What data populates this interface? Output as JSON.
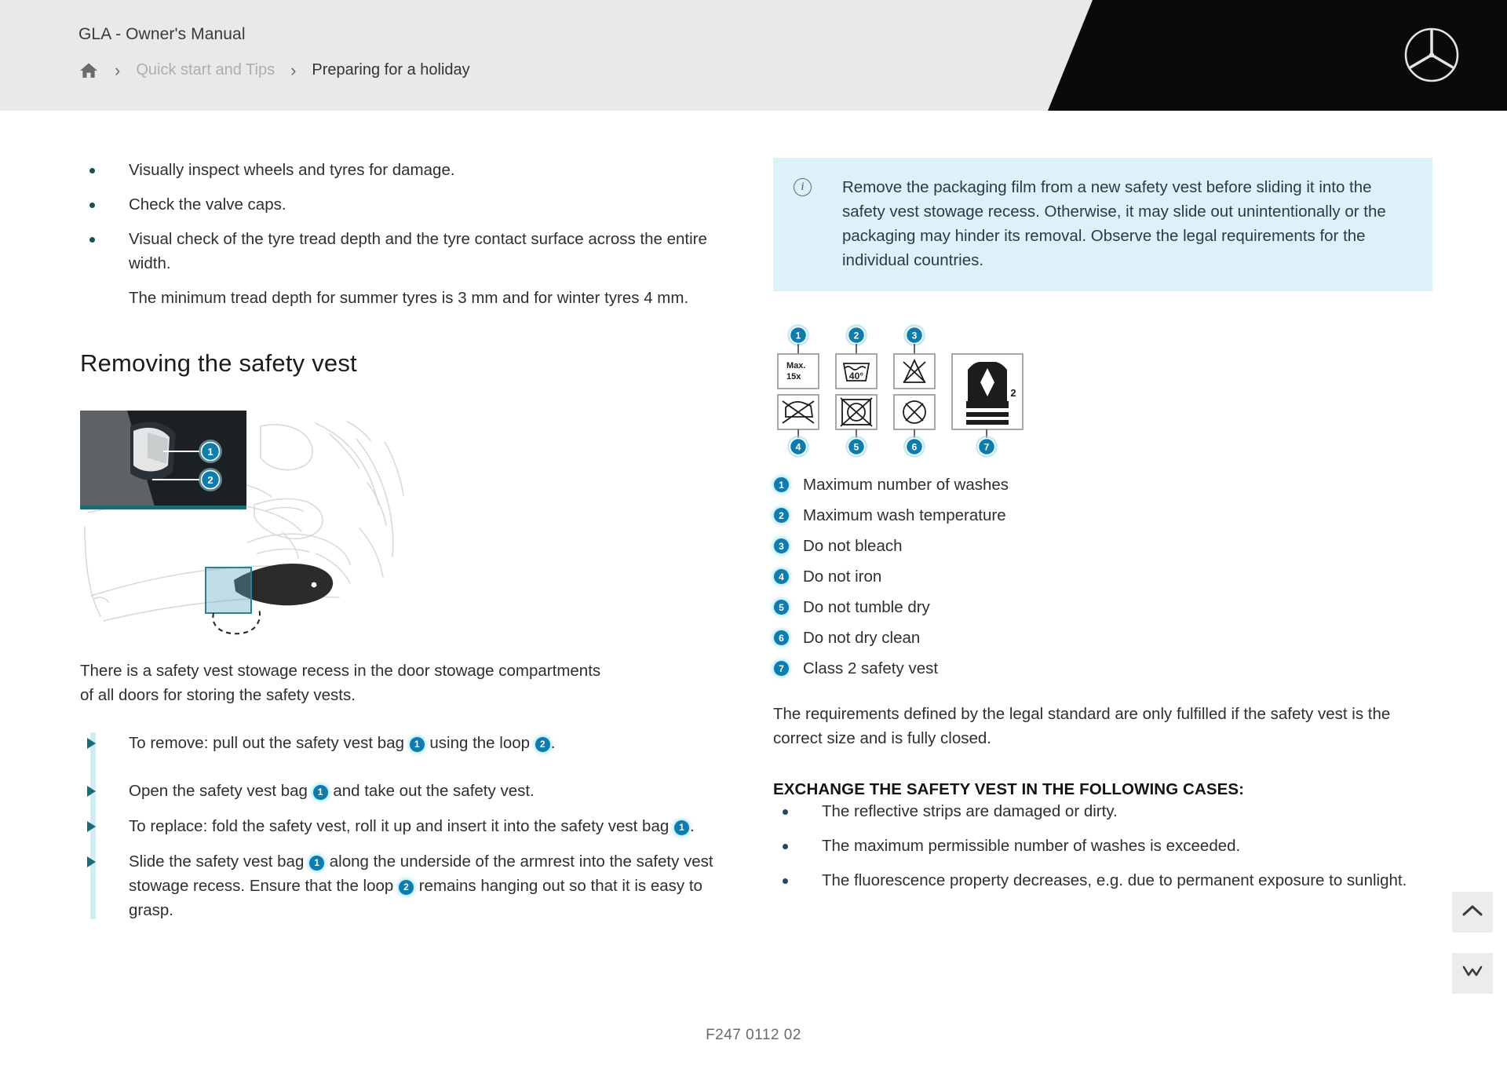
{
  "header": {
    "manual_title": "GLA - Owner's Manual",
    "breadcrumb": {
      "home_icon": "home-icon",
      "separator": "›",
      "parent": "Quick start and Tips",
      "current": "Preparing for a holiday"
    },
    "logo": "mercedes-benz-star-icon",
    "black_bg": "#0a0a0a",
    "bar_bg": "#e9e9e9"
  },
  "left_column": {
    "checklist": [
      "Visually inspect wheels and tyres for damage.",
      "Check the valve caps.",
      "Visual check of the tyre tread depth and the tyre contact surface across the entire width."
    ],
    "checklist_note": "The minimum tread depth for summer tyres is 3 mm and for winter tyres 4 mm.",
    "section_heading": "Removing the safety vest",
    "illustration": {
      "name": "door-stowage-safety-vest-illustration",
      "callouts": [
        "1",
        "2"
      ]
    },
    "intro_paragraph": "There is a safety vest stowage recess in the door stowage compartments of all doors for storing the safety vests.",
    "steps": [
      {
        "parts": [
          "To remove: pull out the safety vest bag ",
          "1",
          " using the loop ",
          "2",
          "."
        ]
      },
      {
        "parts": [
          "Open the safety vest bag ",
          "1",
          " and take out the safety vest."
        ]
      },
      {
        "parts": [
          "To replace: fold the safety vest, roll it up and insert it into the safety vest bag ",
          "1",
          "."
        ]
      },
      {
        "parts": [
          "Slide the safety vest bag ",
          "1",
          " along the underside of the armrest into the safety vest stowage recess. Ensure that the loop ",
          "2",
          " remains hanging out so that it is easy to grasp."
        ]
      }
    ]
  },
  "right_column": {
    "info_box": {
      "icon": "info-icon",
      "icon_glyph": "i",
      "text": "Remove the packaging film from a new safety vest before sliding it into the safety vest stowage recess. Otherwise, it may slide out unintentionally or the packaging may hinder its removal. Observe the legal requirements for the individual countries.",
      "bg_color": "#ddf1f9"
    },
    "care_symbols": {
      "name": "safety-vest-care-symbols-diagram",
      "symbol_1_label": "Max. 15x",
      "symbol_2_label": "40°",
      "vest_class_label": "2",
      "callouts": [
        "1",
        "2",
        "3",
        "4",
        "5",
        "6",
        "7"
      ]
    },
    "legend": [
      {
        "num": "1",
        "label": "Maximum number of washes"
      },
      {
        "num": "2",
        "label": "Maximum wash temperature"
      },
      {
        "num": "3",
        "label": "Do not bleach"
      },
      {
        "num": "4",
        "label": "Do not iron"
      },
      {
        "num": "5",
        "label": "Do not tumble dry"
      },
      {
        "num": "6",
        "label": "Do not dry clean"
      },
      {
        "num": "7",
        "label": "Class 2 safety vest"
      }
    ],
    "requirements_paragraph": "The requirements defined by the legal standard are only fulfilled if the safety vest is the correct size and is fully closed.",
    "exchange_heading": "EXCHANGE THE SAFETY VEST IN THE FOLLOWING CASES:",
    "exchange_cases": [
      "The reflective strips are damaged or dirty.",
      "The maximum permissible number of washes is exceeded.",
      "The fluorescence property decreases, e.g. due to permanent exposure to sunlight."
    ]
  },
  "footer": {
    "figure_code": "F247 0112 02"
  },
  "floating_buttons": [
    {
      "name": "scroll-to-top-button",
      "icon": "chevron-up-icon"
    },
    {
      "name": "collapse-all-button",
      "icon": "double-chevron-icon"
    }
  ],
  "colors": {
    "accent_blue": "#0f7cab",
    "rail_cyan": "#cdeef5",
    "info_bg": "#ddf1f9",
    "arrow_teal": "#1d6b74"
  }
}
